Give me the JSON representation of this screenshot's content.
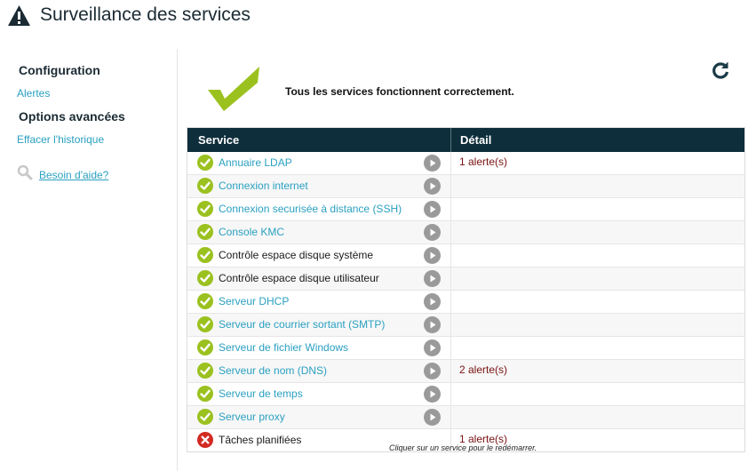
{
  "header": {
    "title": "Surveillance des services",
    "icon": "warning-icon"
  },
  "sidebar": {
    "configuration_heading": "Configuration",
    "alerts_link": "Alertes",
    "advanced_heading": "Options avancées",
    "clear_history_link": "Effacer l'historique",
    "help_link": "Besoin d'aide?"
  },
  "status": {
    "message": "Tous les services fonctionnent correctement."
  },
  "table": {
    "columns": [
      "Service",
      "Détail"
    ],
    "rows": [
      {
        "service": "Annuaire LDAP",
        "detail": "1 alerte(s)",
        "status": "ok",
        "link": true
      },
      {
        "service": "Connexion internet",
        "detail": "",
        "status": "ok",
        "link": true
      },
      {
        "service": "Connexion securisée à distance (SSH)",
        "detail": "",
        "status": "ok",
        "link": true
      },
      {
        "service": "Console KMC",
        "detail": "",
        "status": "ok",
        "link": true
      },
      {
        "service": "Contrôle espace disque système",
        "detail": "",
        "status": "ok",
        "link": false
      },
      {
        "service": "Contrôle espace disque utilisateur",
        "detail": "",
        "status": "ok",
        "link": false
      },
      {
        "service": "Serveur DHCP",
        "detail": "",
        "status": "ok",
        "link": true
      },
      {
        "service": "Serveur de courrier sortant (SMTP)",
        "detail": "",
        "status": "ok",
        "link": true
      },
      {
        "service": "Serveur de fichier Windows",
        "detail": "",
        "status": "ok",
        "link": true
      },
      {
        "service": "Serveur de nom (DNS)",
        "detail": "2 alerte(s)",
        "status": "ok",
        "link": true
      },
      {
        "service": "Serveur de temps",
        "detail": "",
        "status": "ok",
        "link": true
      },
      {
        "service": "Serveur proxy",
        "detail": "",
        "status": "ok",
        "link": true
      },
      {
        "service": "Tâches planifiées",
        "detail": "1 alerte(s)",
        "status": "error",
        "link": false
      }
    ]
  },
  "footnote": "Cliquer sur un service pour le redémarrer.",
  "colors": {
    "ok": "#9bc11f",
    "error": "#d22a22",
    "link": "#2aa0c0",
    "header_bg": "#0e2e3b",
    "alert_text": "#7a1212"
  }
}
